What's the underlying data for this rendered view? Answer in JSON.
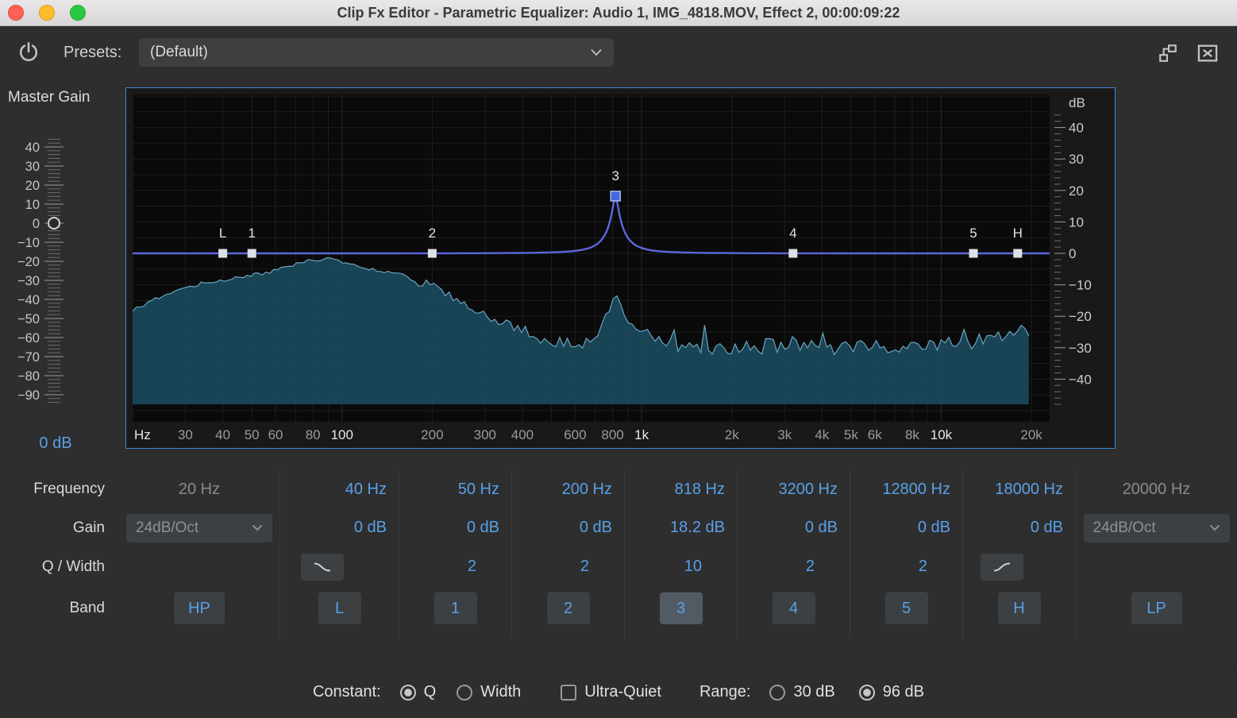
{
  "window": {
    "title": "Clip Fx Editor - Parametric Equalizer: Audio 1, IMG_4818.MOV, Effect 2, 00:00:09:22"
  },
  "toolbar": {
    "presets_label": "Presets:",
    "preset_value": "(Default)"
  },
  "master_gain": {
    "label": "Master Gain",
    "value": "0 dB",
    "knob_db": 0,
    "ticks": [
      {
        "db": 40,
        "label": "40"
      },
      {
        "db": 30,
        "label": "30"
      },
      {
        "db": 20,
        "label": "20"
      },
      {
        "db": 10,
        "label": "10"
      },
      {
        "db": 0,
        "label": "0"
      },
      {
        "db": -10,
        "label": "−10"
      },
      {
        "db": -20,
        "label": "−20"
      },
      {
        "db": -30,
        "label": "−30"
      },
      {
        "db": -40,
        "label": "−40"
      },
      {
        "db": -50,
        "label": "−50"
      },
      {
        "db": -60,
        "label": "−60"
      },
      {
        "db": -70,
        "label": "−70"
      },
      {
        "db": -80,
        "label": "−80"
      },
      {
        "db": -90,
        "label": "−90"
      }
    ]
  },
  "graph": {
    "x_unit_label": "Hz",
    "y_unit_label": "dB",
    "freq_min": 20,
    "freq_max": 23000,
    "x_ticks": [
      {
        "f": 30,
        "label": "30"
      },
      {
        "f": 40,
        "label": "40"
      },
      {
        "f": 50,
        "label": "50"
      },
      {
        "f": 60,
        "label": "60"
      },
      {
        "f": 80,
        "label": "80"
      },
      {
        "f": 100,
        "label": "100",
        "strong": true
      },
      {
        "f": 200,
        "label": "200"
      },
      {
        "f": 300,
        "label": "300"
      },
      {
        "f": 400,
        "label": "400"
      },
      {
        "f": 600,
        "label": "600"
      },
      {
        "f": 800,
        "label": "800"
      },
      {
        "f": 1000,
        "label": "1k",
        "strong": true
      },
      {
        "f": 2000,
        "label": "2k"
      },
      {
        "f": 3000,
        "label": "3k"
      },
      {
        "f": 4000,
        "label": "4k"
      },
      {
        "f": 5000,
        "label": "5k"
      },
      {
        "f": 6000,
        "label": "6k"
      },
      {
        "f": 8000,
        "label": "8k"
      },
      {
        "f": 10000,
        "label": "10k",
        "strong": true
      },
      {
        "f": 20000,
        "label": "20k"
      }
    ],
    "y_ticks": [
      {
        "db": 40,
        "label": "40"
      },
      {
        "db": 30,
        "label": "30"
      },
      {
        "db": 20,
        "label": "20"
      },
      {
        "db": 10,
        "label": "10"
      },
      {
        "db": 0,
        "label": "0"
      },
      {
        "db": -10,
        "label": "−10"
      },
      {
        "db": -20,
        "label": "−20"
      },
      {
        "db": -30,
        "label": "−30"
      },
      {
        "db": -40,
        "label": "−40"
      }
    ],
    "bands": [
      {
        "id": "L",
        "freq": 40,
        "gain": 0,
        "type": "low-shelf"
      },
      {
        "id": "1",
        "freq": 50,
        "gain": 0,
        "q": 2,
        "type": "peak"
      },
      {
        "id": "2",
        "freq": 200,
        "gain": 0,
        "q": 2,
        "type": "peak"
      },
      {
        "id": "3",
        "freq": 818,
        "gain": 18.2,
        "q": 10,
        "type": "peak",
        "selected": true
      },
      {
        "id": "4",
        "freq": 3200,
        "gain": 0,
        "q": 2,
        "type": "peak"
      },
      {
        "id": "5",
        "freq": 12800,
        "gain": 0,
        "q": 2,
        "type": "peak"
      },
      {
        "id": "H",
        "freq": 18000,
        "gain": 0,
        "type": "high-shelf"
      }
    ],
    "spectrum_floor_db": -48,
    "spectrum_envelope": [
      [
        20,
        -18.2
      ],
      [
        25,
        -13.6
      ],
      [
        32,
        -10.1
      ],
      [
        45,
        -7.6
      ],
      [
        60,
        -5.6
      ],
      [
        75,
        -2.5
      ],
      [
        90,
        -1.8
      ],
      [
        105,
        -3.5
      ],
      [
        120,
        -4.5
      ],
      [
        140,
        -6.1
      ],
      [
        170,
        -8.1
      ],
      [
        200,
        -10.6
      ],
      [
        250,
        -15.2
      ],
      [
        320,
        -20.7
      ],
      [
        400,
        -24.5
      ],
      [
        500,
        -27.8
      ],
      [
        650,
        -27.8
      ],
      [
        740,
        -24.5
      ],
      [
        818,
        -12.6
      ],
      [
        900,
        -20.7
      ],
      [
        1000,
        -23.7
      ],
      [
        1200,
        -28.3
      ],
      [
        1500,
        -29.5
      ],
      [
        2000,
        -30.8
      ],
      [
        3000,
        -28.8
      ],
      [
        4000,
        -30.3
      ],
      [
        5000,
        -29.8
      ],
      [
        7000,
        -29.3
      ],
      [
        9000,
        -29.8
      ],
      [
        11000,
        -28.8
      ],
      [
        14000,
        -27.8
      ],
      [
        17000,
        -25.8
      ],
      [
        18500,
        -23.2
      ],
      [
        19600,
        -24.5
      ]
    ]
  },
  "bands_panel": {
    "row_labels": [
      "Frequency",
      "Gain",
      "Q / Width",
      "Band"
    ],
    "columns": [
      {
        "band": "HP",
        "freq": "20 Hz",
        "slope": "24dB/Oct",
        "disabled": true
      },
      {
        "band": "L",
        "freq": "40 Hz",
        "gain": "0 dB",
        "shape": "low-shelf"
      },
      {
        "band": "1",
        "freq": "50 Hz",
        "gain": "0 dB",
        "q": "2"
      },
      {
        "band": "2",
        "freq": "200 Hz",
        "gain": "0 dB",
        "q": "2"
      },
      {
        "band": "3",
        "freq": "818 Hz",
        "gain": "18.2 dB",
        "q": "10",
        "selected": true
      },
      {
        "band": "4",
        "freq": "3200 Hz",
        "gain": "0 dB",
        "q": "2"
      },
      {
        "band": "5",
        "freq": "12800 Hz",
        "gain": "0 dB",
        "q": "2"
      },
      {
        "band": "H",
        "freq": "18000 Hz",
        "gain": "0 dB",
        "shape": "high-shelf"
      },
      {
        "band": "LP",
        "freq": "20000 Hz",
        "slope": "24dB/Oct",
        "disabled": true
      }
    ]
  },
  "footer": {
    "constant_label": "Constant:",
    "constant_q": {
      "label": "Q",
      "selected": true
    },
    "constant_width": {
      "label": "Width",
      "selected": false
    },
    "ultra_quiet": {
      "label": "Ultra-Quiet",
      "checked": false
    },
    "range_label": "Range:",
    "range_30": {
      "label": "30 dB",
      "selected": false
    },
    "range_96": {
      "label": "96 dB",
      "selected": true
    }
  },
  "colors": {
    "accent_blue": "#58a0e8",
    "curve": "#5c68dd",
    "handle": "#dde1e6",
    "handle_selected": "#4566dd",
    "spectrum_fill": "#1a4a5c",
    "spectrum_line": "#6aa5c0",
    "frame_border": "#3b87d8",
    "value_disabled": "#8a8a8a"
  }
}
